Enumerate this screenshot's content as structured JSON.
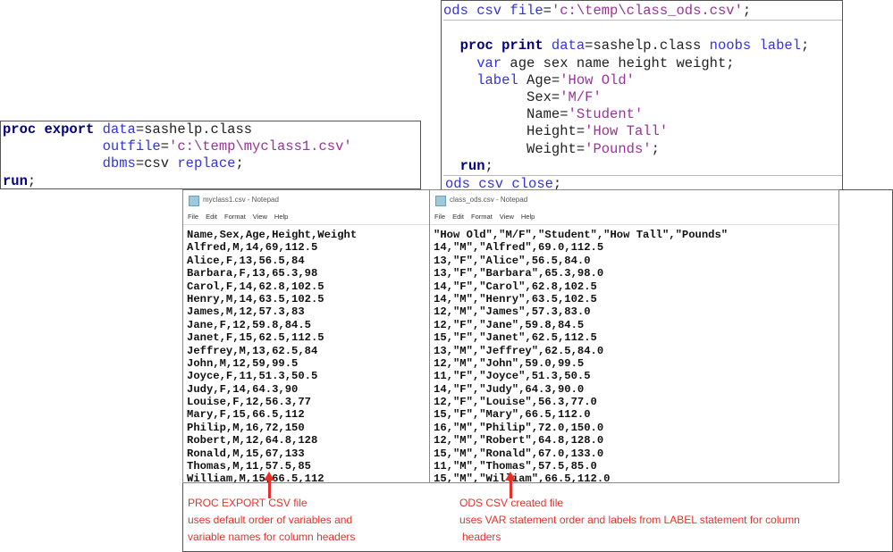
{
  "export_code": [
    [
      {
        "t": "proc export ",
        "c": "kw"
      },
      {
        "t": "data",
        "c": "bl"
      },
      {
        "t": "=sashelp.class",
        "c": "pl"
      }
    ],
    [
      {
        "t": "            outfile",
        "c": "bl"
      },
      {
        "t": "=",
        "c": "pl"
      },
      {
        "t": "'c:\\temp\\myclass1.csv'",
        "c": "st"
      }
    ],
    [
      {
        "t": "            dbms",
        "c": "bl"
      },
      {
        "t": "=csv ",
        "c": "pl"
      },
      {
        "t": "replace",
        "c": "bl"
      },
      {
        "t": ";",
        "c": "pl"
      }
    ],
    [
      {
        "t": "run",
        "c": "kw"
      },
      {
        "t": ";",
        "c": "pl"
      }
    ]
  ],
  "ods_code": [
    [
      {
        "t": "ods csv file",
        "c": "bl"
      },
      {
        "t": "=",
        "c": "pl"
      },
      {
        "t": "'c:\\temp\\class_ods.csv'",
        "c": "st"
      },
      {
        "t": ";",
        "c": "pl"
      }
    ],
    [
      {
        "t": "",
        "c": "pl"
      }
    ],
    [
      {
        "t": "  proc print ",
        "c": "kw"
      },
      {
        "t": "data",
        "c": "bl"
      },
      {
        "t": "=sashelp.class ",
        "c": "pl"
      },
      {
        "t": "noobs label",
        "c": "bl"
      },
      {
        "t": ";",
        "c": "pl"
      }
    ],
    [
      {
        "t": "    var ",
        "c": "bl"
      },
      {
        "t": "age sex name height weight;",
        "c": "pl"
      }
    ],
    [
      {
        "t": "    label ",
        "c": "bl"
      },
      {
        "t": "Age=",
        "c": "pl"
      },
      {
        "t": "'How Old'",
        "c": "st"
      }
    ],
    [
      {
        "t": "          Sex=",
        "c": "pl"
      },
      {
        "t": "'M/F'",
        "c": "st"
      }
    ],
    [
      {
        "t": "          Name=",
        "c": "pl"
      },
      {
        "t": "'Student'",
        "c": "st"
      }
    ],
    [
      {
        "t": "          Height=",
        "c": "pl"
      },
      {
        "t": "'How Tall'",
        "c": "st"
      }
    ],
    [
      {
        "t": "          Weight=",
        "c": "pl"
      },
      {
        "t": "'Pounds'",
        "c": "st"
      },
      {
        "t": ";",
        "c": "pl"
      }
    ],
    [
      {
        "t": "  run",
        "c": "kw"
      },
      {
        "t": ";",
        "c": "pl"
      }
    ],
    [
      {
        "t": "ods csv close",
        "c": "bl"
      },
      {
        "t": ";",
        "c": "pl"
      }
    ]
  ],
  "notepad1": {
    "title": "myclass1.csv - Notepad",
    "menu": [
      "File",
      "Edit",
      "Format",
      "View",
      "Help"
    ],
    "lines": [
      "Name,Sex,Age,Height,Weight",
      "Alfred,M,14,69,112.5",
      "Alice,F,13,56.5,84",
      "Barbara,F,13,65.3,98",
      "Carol,F,14,62.8,102.5",
      "Henry,M,14,63.5,102.5",
      "James,M,12,57.3,83",
      "Jane,F,12,59.8,84.5",
      "Janet,F,15,62.5,112.5",
      "Jeffrey,M,13,62.5,84",
      "John,M,12,59,99.5",
      "Joyce,F,11,51.3,50.5",
      "Judy,F,14,64.3,90",
      "Louise,F,12,56.3,77",
      "Mary,F,15,66.5,112",
      "Philip,M,16,72,150",
      "Robert,M,12,64.8,128",
      "Ronald,M,15,67,133",
      "Thomas,M,11,57.5,85",
      "William,M,15,66.5,112"
    ]
  },
  "notepad2": {
    "title": "class_ods.csv - Notepad",
    "menu": [
      "File",
      "Edit",
      "Format",
      "View",
      "Help"
    ],
    "lines": [
      "\"How Old\",\"M/F\",\"Student\",\"How Tall\",\"Pounds\"",
      "14,\"M\",\"Alfred\",69.0,112.5",
      "13,\"F\",\"Alice\",56.5,84.0",
      "13,\"F\",\"Barbara\",65.3,98.0",
      "14,\"F\",\"Carol\",62.8,102.5",
      "14,\"M\",\"Henry\",63.5,102.5",
      "12,\"M\",\"James\",57.3,83.0",
      "12,\"F\",\"Jane\",59.8,84.5",
      "15,\"F\",\"Janet\",62.5,112.5",
      "13,\"M\",\"Jeffrey\",62.5,84.0",
      "12,\"M\",\"John\",59.0,99.5",
      "11,\"F\",\"Joyce\",51.3,50.5",
      "14,\"F\",\"Judy\",64.3,90.0",
      "12,\"F\",\"Louise\",56.3,77.0",
      "15,\"F\",\"Mary\",66.5,112.0",
      "16,\"M\",\"Philip\",72.0,150.0",
      "12,\"M\",\"Robert\",64.8,128.0",
      "15,\"M\",\"Ronald\",67.0,133.0",
      "11,\"M\",\"Thomas\",57.5,85.0",
      "15,\"M\",\"William\",66.5,112.0"
    ]
  },
  "notes": {
    "left": [
      "PROC EXPORT CSV file",
      "uses default order of variables and",
      "variable names for column headers"
    ],
    "right": [
      "ODS CSV created file",
      "uses VAR statement order and labels from LABEL statement for column",
      "headers"
    ]
  },
  "colors": {
    "annotation": "#e8302a",
    "keyword": "#000080",
    "option": "#3333dd",
    "string": "#993399"
  }
}
